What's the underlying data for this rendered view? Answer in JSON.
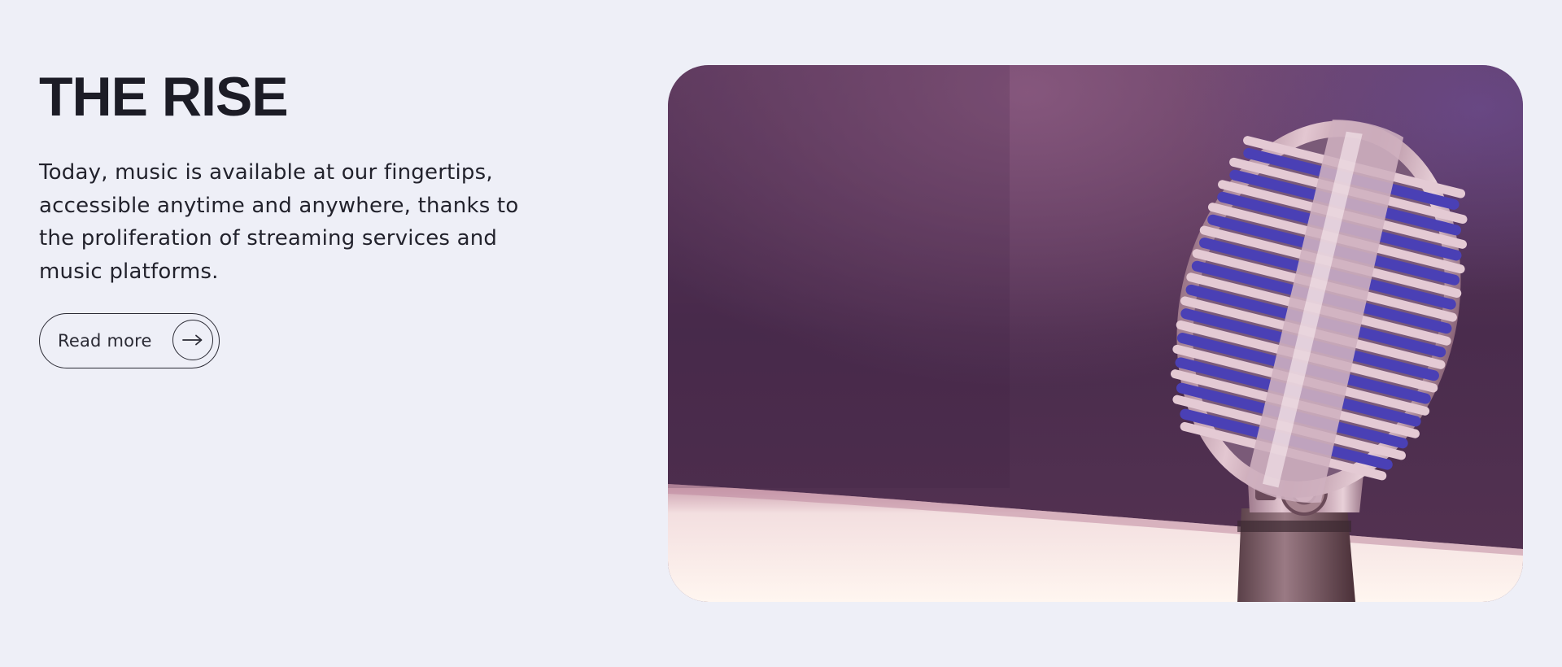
{
  "section": {
    "title": "THE RISE",
    "body": "Today, music is available at our fingertips, accessible anytime and anywhere, thanks to the proliferation of streaming services and music platforms.",
    "cta": {
      "label": "Read more",
      "icon": "arrow-right-icon"
    }
  },
  "media": {
    "subject": "microphone-image",
    "colors": {
      "background": "#eeeff7",
      "stage_dark": "#3f2640",
      "stage_light": "#7a4d74",
      "grille_blue": "#4a3fb0",
      "chrome": "#d6b7c6"
    }
  }
}
